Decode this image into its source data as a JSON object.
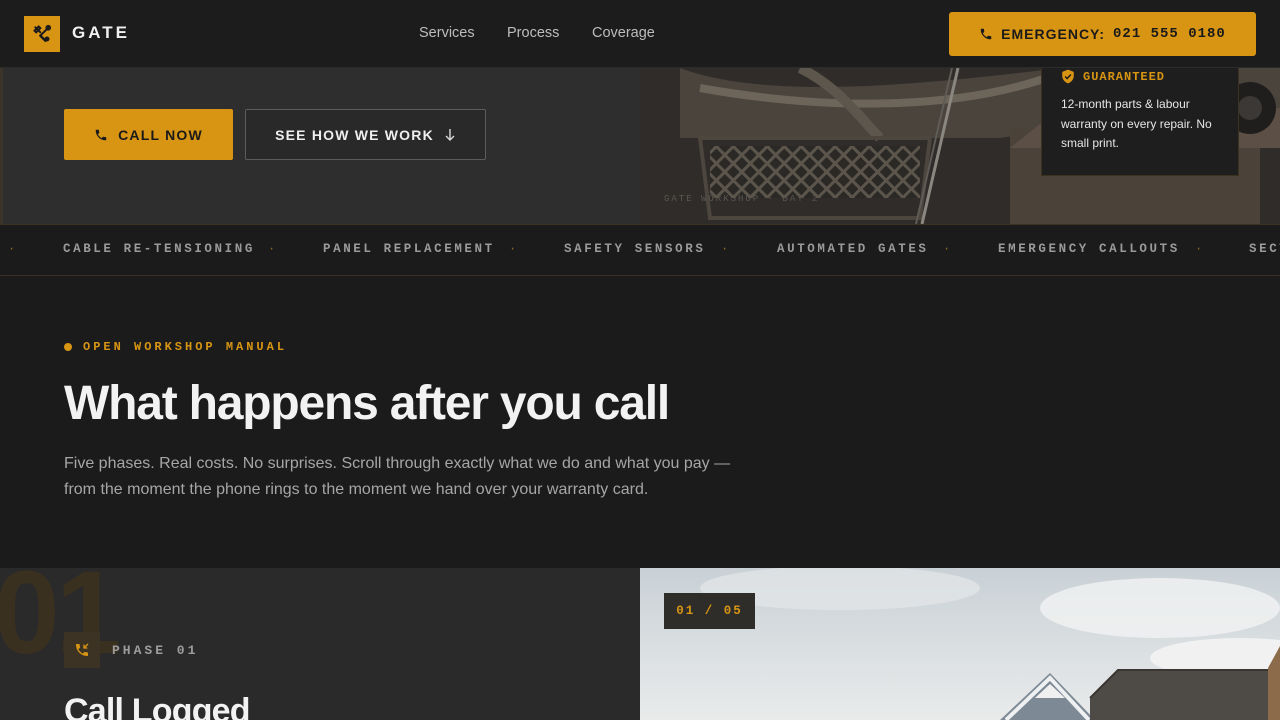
{
  "brand": {
    "name": "GATE",
    "accent": "#d89513",
    "icon": "tools-icon"
  },
  "nav": {
    "links": [
      "Services",
      "Process",
      "Coverage"
    ],
    "emergency_label": "EMERGENCY:",
    "emergency_number": "021 555 0180"
  },
  "hero": {
    "call_now": "CALL NOW",
    "see_how": "SEE HOW WE WORK",
    "photo_caption": "GATE WORKSHOP · BAY 2"
  },
  "guarantee": {
    "title": "GUARANTEED",
    "body": "12-month parts & labour warranty on every repair. No small print."
  },
  "ticker": [
    "CABLE RE-TENSIONING",
    "PANEL REPLACEMENT",
    "SAFETY SENSORS",
    "AUTOMATED GATES",
    "EMERGENCY CALLOUTS",
    "SECT"
  ],
  "manual": {
    "eyebrow": "OPEN WORKSHOP MANUAL",
    "heading": "What happens after you call",
    "subtext": "Five phases. Real costs. No surprises. Scroll through exactly what we do and what you pay — from the moment the phone rings to the moment we hand over your warranty card."
  },
  "phase": {
    "big_number": "01",
    "label": "PHASE 01",
    "title": "Call Logged",
    "counter": "01 / 05"
  }
}
